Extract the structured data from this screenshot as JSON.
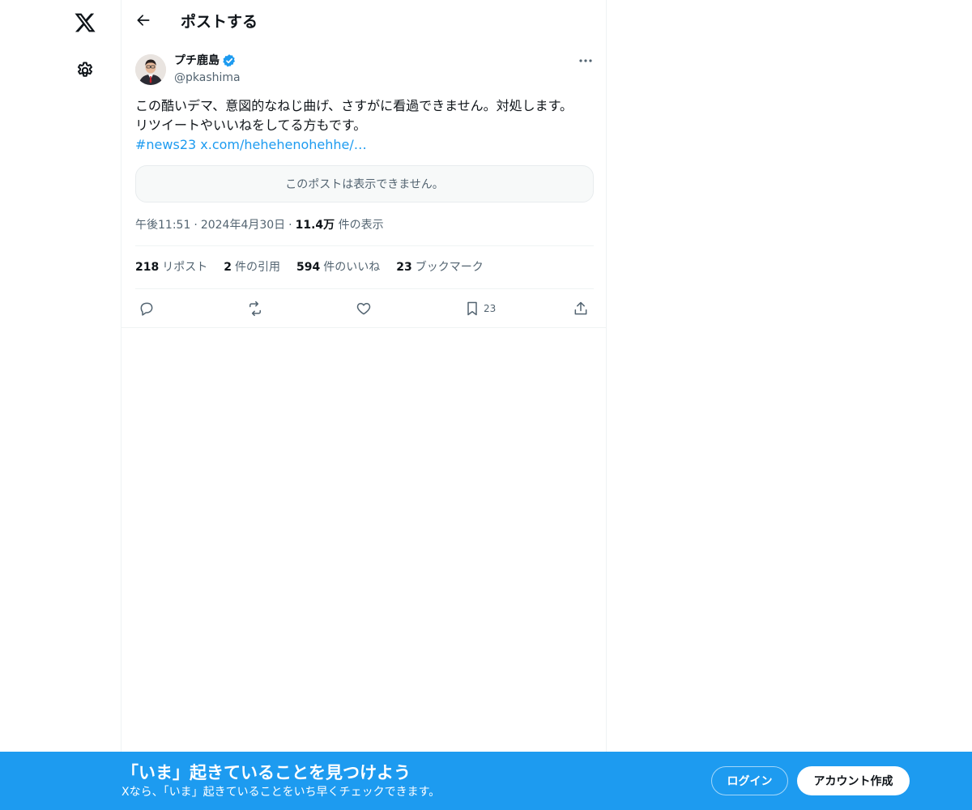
{
  "nav": {
    "logo_icon": "x-logo-icon",
    "settings_icon": "gear-icon"
  },
  "header": {
    "back_icon": "arrow-left-icon",
    "title": "ポストする"
  },
  "post": {
    "author_name": "プチ鹿島",
    "author_handle": "@pkashima",
    "verified_icon": "verified-badge-icon",
    "text": "この酷いデマ、意図的なねじ曲げ、さすがに看過できません。対処します。リツイートやいいねをしてる方もです。",
    "hashtag": "#news23",
    "link": "x.com/hehehenohehhe/…",
    "unavailable_text": "このポストは表示できません。",
    "time": "午後11:51",
    "date": "2024年4月30日",
    "dot": "·",
    "views_count": "11.4万",
    "views_label": "件の表示"
  },
  "stats": {
    "reposts_count": "218",
    "reposts_label": "リポスト",
    "quotes_count": "2",
    "quotes_label": "件の引用",
    "likes_count": "594",
    "likes_label": "件のいいね",
    "bookmarks_count": "23",
    "bookmarks_label": "ブックマーク"
  },
  "actions": {
    "reply_icon": "reply-icon",
    "repost_icon": "repost-icon",
    "like_icon": "heart-icon",
    "bookmark_icon": "bookmark-icon",
    "bookmark_count": "23",
    "share_icon": "share-icon"
  },
  "banner": {
    "title": "「いま」起きていることを見つけよう",
    "subtitle": "Xなら、「いま」起きていることをいち早くチェックできます。",
    "login_label": "ログイン",
    "signup_label": "アカウント作成"
  },
  "colors": {
    "accent": "#1d9bf0",
    "text": "#0f1419",
    "muted": "#536471",
    "border": "#eff3f4"
  }
}
